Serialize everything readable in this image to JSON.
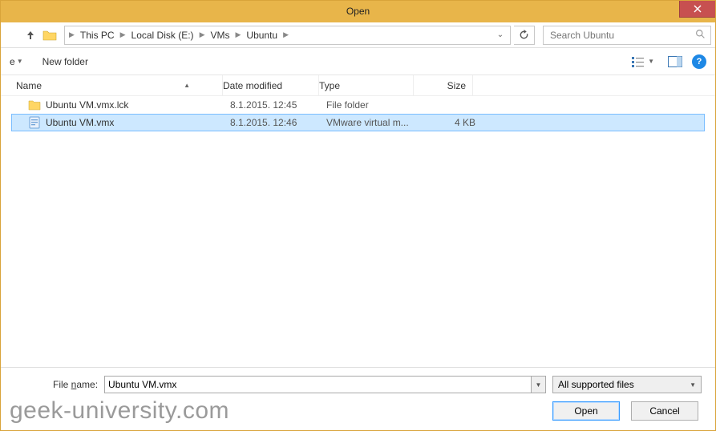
{
  "window": {
    "title": "Open"
  },
  "breadcrumbs": {
    "items": [
      "This PC",
      "Local Disk (E:)",
      "VMs",
      "Ubuntu"
    ]
  },
  "search": {
    "placeholder": "Search Ubuntu"
  },
  "toolbar": {
    "organize": "e",
    "new_folder": "New folder"
  },
  "columns": {
    "name": "Name",
    "date": "Date modified",
    "type": "Type",
    "size": "Size"
  },
  "files": [
    {
      "name": "Ubuntu VM.vmx.lck",
      "date": "8.1.2015. 12:45",
      "type": "File folder",
      "size": "",
      "kind": "folder",
      "selected": false
    },
    {
      "name": "Ubuntu VM.vmx",
      "date": "8.1.2015. 12:46",
      "type": "VMware virtual m...",
      "size": "4 KB",
      "kind": "vmx",
      "selected": true
    }
  ],
  "footer": {
    "filename_label_pre": "File ",
    "filename_label_u": "n",
    "filename_label_post": "ame:",
    "filename_value": "Ubuntu VM.vmx",
    "filter": "All supported files",
    "open": "Open",
    "cancel": "Cancel"
  },
  "watermark": "geek-university.com"
}
